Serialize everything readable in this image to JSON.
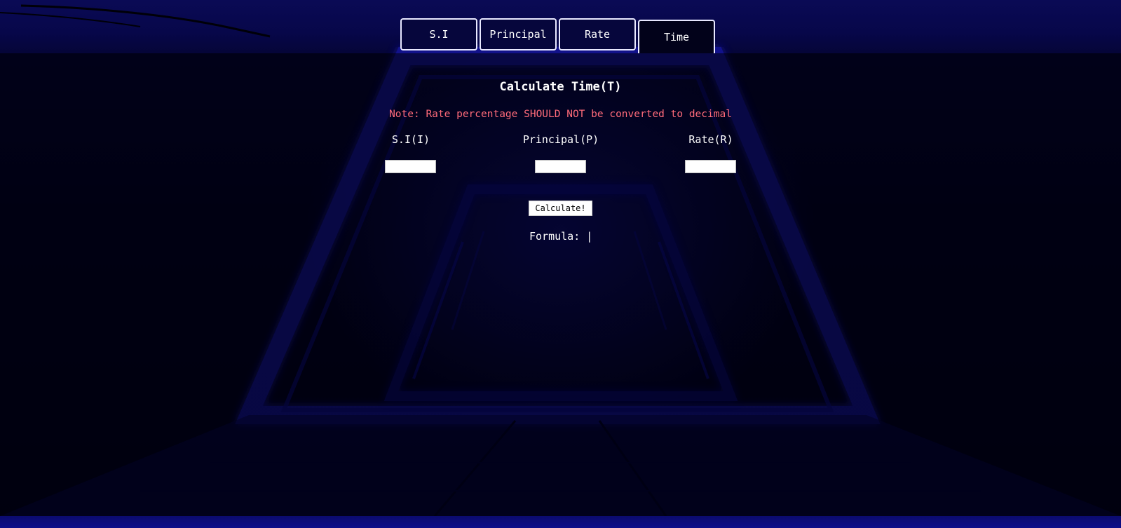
{
  "tabs": [
    {
      "label": "S.I",
      "active": false
    },
    {
      "label": "Principal",
      "active": false
    },
    {
      "label": "Rate",
      "active": false
    },
    {
      "label": "Time",
      "active": true
    }
  ],
  "heading": "Calculate Time(T)",
  "note": "Note: Rate percentage SHOULD NOT be converted to decimal",
  "fields": [
    {
      "label": "S.I(I)",
      "value": ""
    },
    {
      "label": "Principal(P)",
      "value": ""
    },
    {
      "label": "Rate(R)",
      "value": ""
    }
  ],
  "calculate_button": "Calculate!",
  "formula": {
    "label": "Formula:",
    "value": "|"
  },
  "colors": {
    "background": "#00001a",
    "glow": "#1a1ab0",
    "note": "#ff6b7a",
    "text": "#ffffff"
  }
}
